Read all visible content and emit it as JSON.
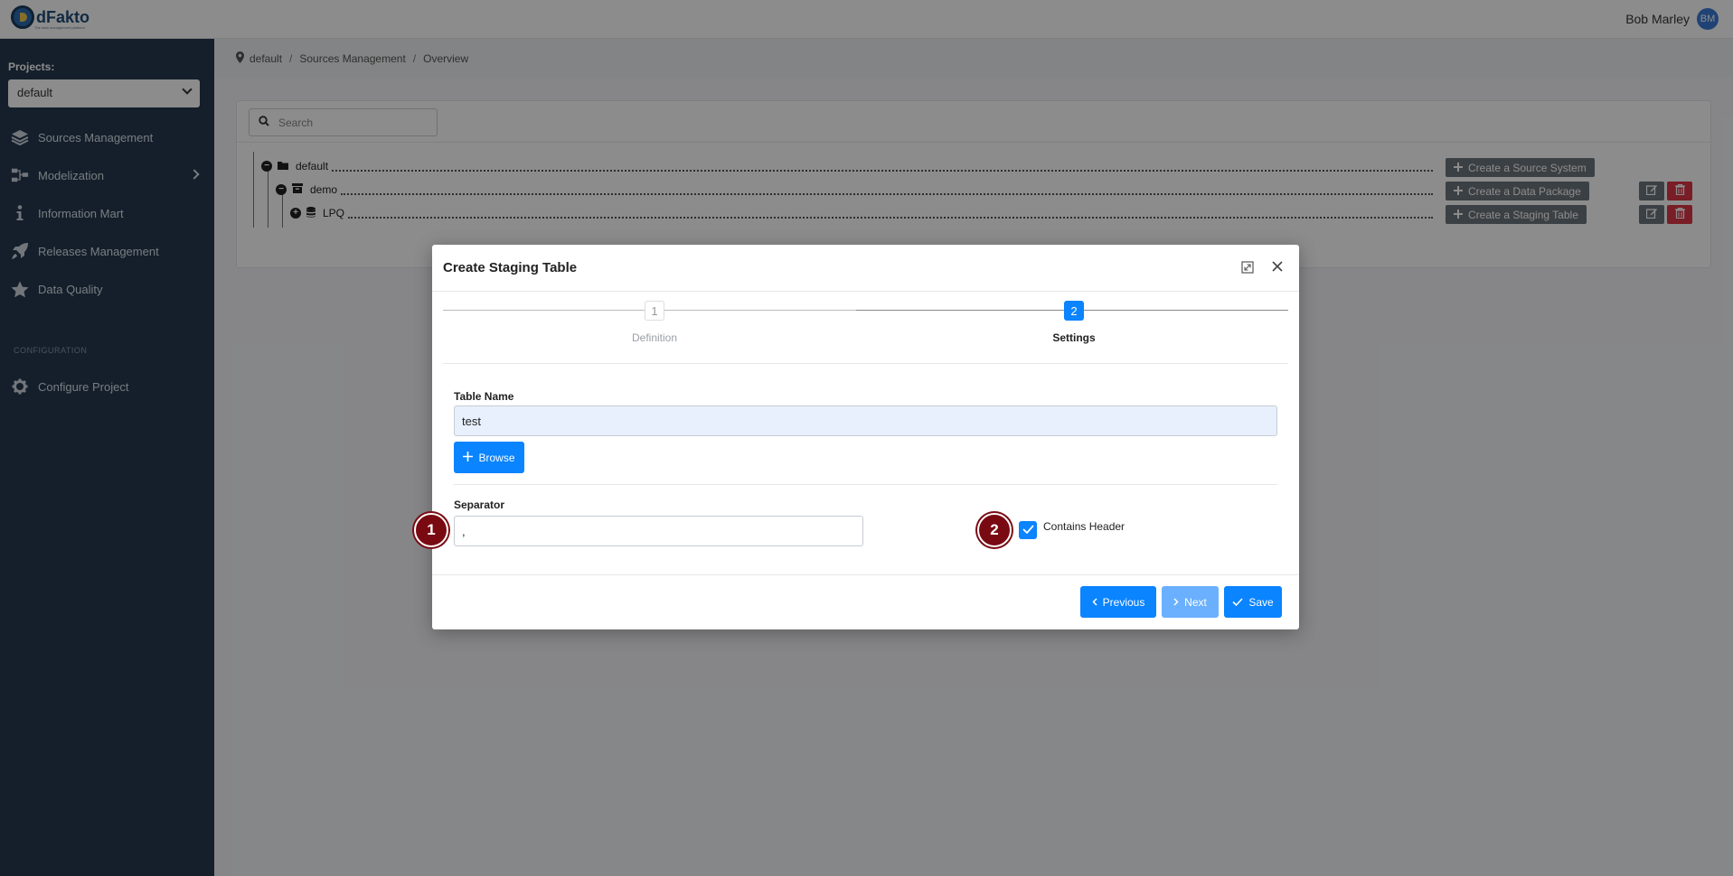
{
  "app": {
    "logo_text": "dFakto",
    "logo_tagline": "The data management platform",
    "user_name": "Bob Marley",
    "user_initials": "BM"
  },
  "sidebar": {
    "projects_label": "Projects:",
    "project_selected": "default",
    "items": [
      {
        "label": "Sources Management",
        "icon": "layers-icon"
      },
      {
        "label": "Modelization",
        "icon": "hierarchy-icon"
      },
      {
        "label": "Information Mart",
        "icon": "info-icon"
      },
      {
        "label": "Releases Management",
        "icon": "rocket-icon"
      },
      {
        "label": "Data Quality",
        "icon": "star-icon"
      }
    ],
    "config_label": "CONFIGURATION",
    "config_item": {
      "label": "Configure Project",
      "icon": "gear-icon"
    }
  },
  "breadcrumb": [
    "default",
    "Sources Management",
    "Overview"
  ],
  "overview": {
    "search_placeholder": "Search",
    "tree": [
      {
        "label": "default",
        "button": "Create a Source System"
      },
      {
        "label": "demo",
        "button": "Create a Data Package"
      },
      {
        "label": "LPQ",
        "button": "Create a Staging Table"
      }
    ]
  },
  "modal": {
    "title": "Create Staging Table",
    "steps": [
      {
        "number": "1",
        "label": "Definition"
      },
      {
        "number": "2",
        "label": "Settings"
      }
    ],
    "table_name_label": "Table Name",
    "table_name_value": "test",
    "browse_label": "Browse",
    "separator_label": "Separator",
    "separator_value": ",",
    "contains_header_label": "Contains Header",
    "contains_header_checked": true,
    "previous_label": "Previous",
    "next_label": "Next",
    "save_label": "Save"
  },
  "markers": [
    "1",
    "2"
  ],
  "colors": {
    "primary": "#0a84ff",
    "sidebar": "#25394f",
    "danger": "#dc3545",
    "marker": "#7a0a12"
  }
}
